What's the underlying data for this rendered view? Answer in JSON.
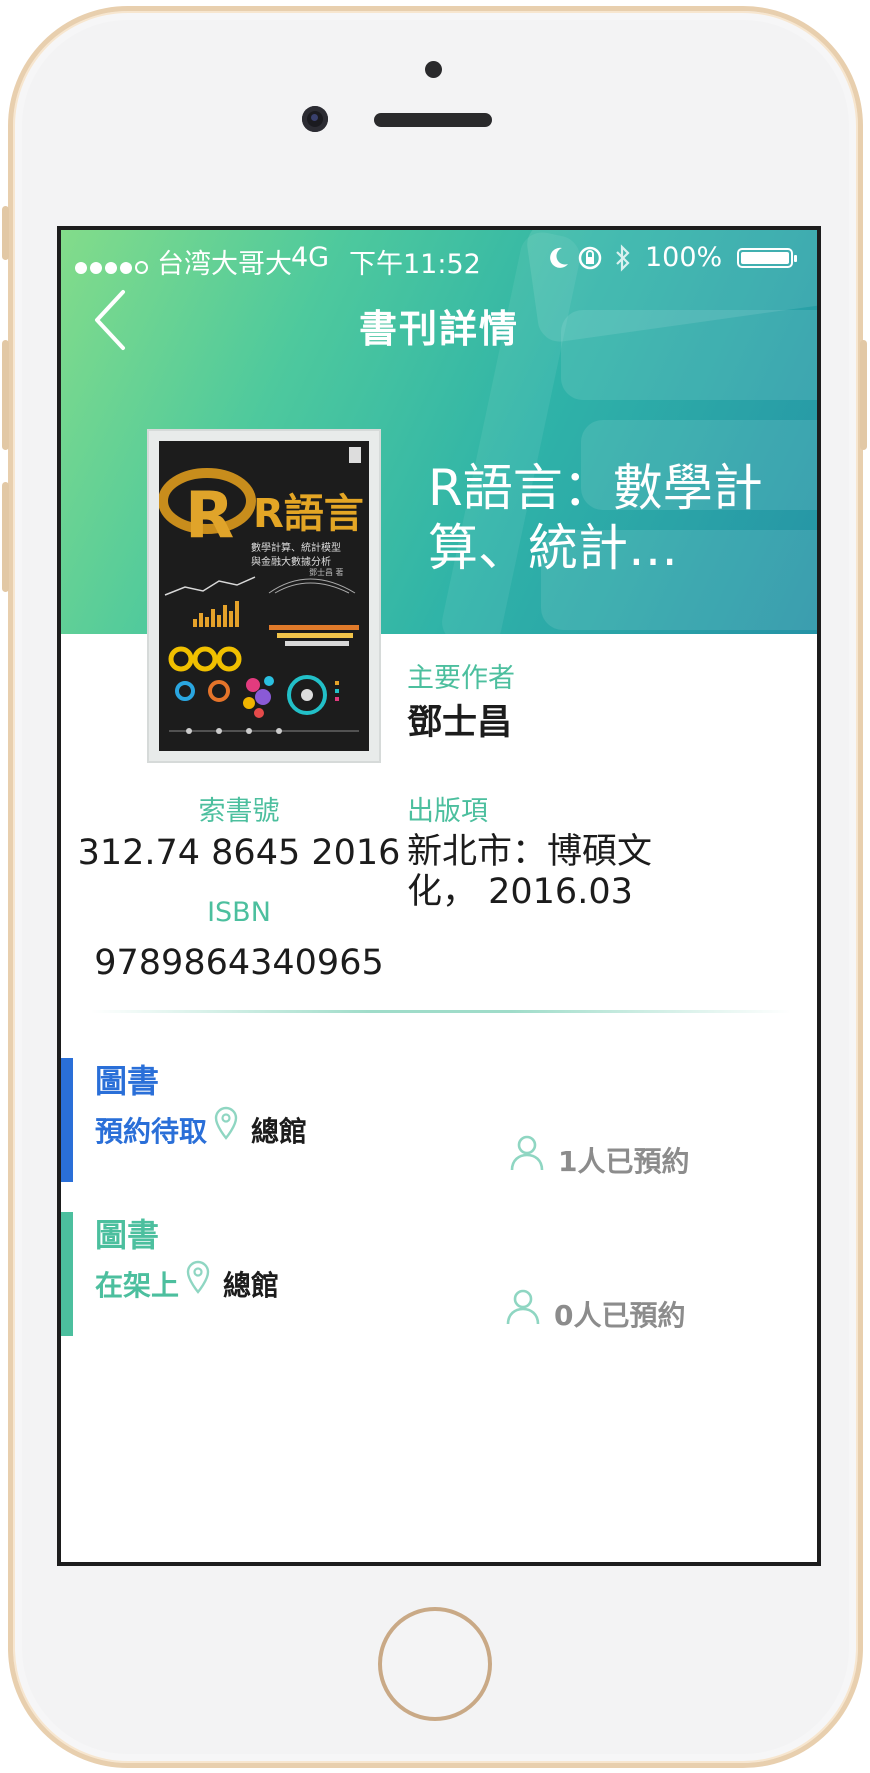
{
  "status_bar": {
    "carrier": "台湾大哥大",
    "network": "4G",
    "time": "下午11:52",
    "battery": "100%"
  },
  "nav": {
    "title": "書刊詳情"
  },
  "book": {
    "title": "R語言：數學計算、統計…",
    "cover": {
      "title": "R語言",
      "subtitle_line1": "數學計算、統計模型",
      "subtitle_line2": "與金融大數據分析",
      "author": "鄧士昌 著"
    },
    "author_label": "主要作者",
    "author": "鄧士昌",
    "call_number_label": "索書號",
    "call_number": "312.74 8645 2016",
    "isbn_label": "ISBN",
    "isbn": "9789864340965",
    "publisher_label": "出版項",
    "publisher": "新北市：博碩文化， 2016.03"
  },
  "holdings": [
    {
      "type": "圖書",
      "status": "預約待取",
      "location": "總館",
      "reservations": "1人已預約",
      "color": "#2a6fd8"
    },
    {
      "type": "圖書",
      "status": "在架上",
      "location": "總館",
      "reservations": "0人已預約",
      "color": "#4cbf9e"
    }
  ],
  "colors": {
    "accent": "#4cbf9e",
    "reserved": "#2a6fd8"
  }
}
